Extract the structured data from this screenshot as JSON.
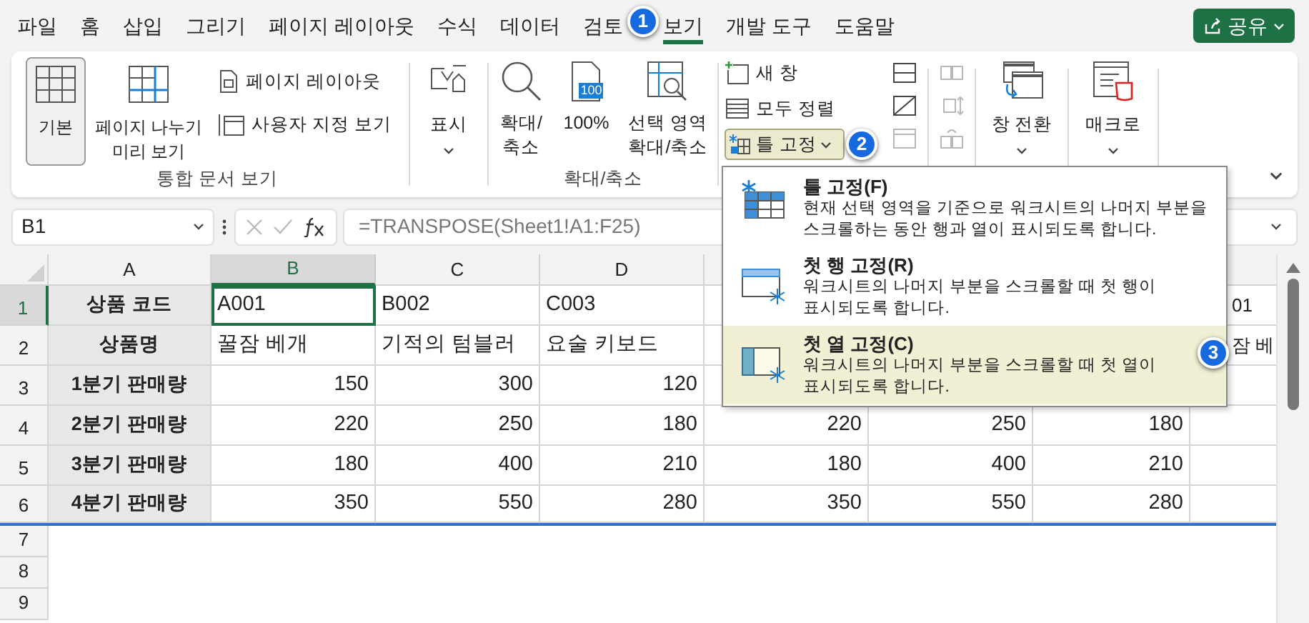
{
  "menu_tabs": [
    {
      "label": "파일",
      "selected": false
    },
    {
      "label": "홈",
      "selected": false
    },
    {
      "label": "삽입",
      "selected": false
    },
    {
      "label": "그리기",
      "selected": false
    },
    {
      "label": "페이지 레이아웃",
      "selected": false
    },
    {
      "label": "수식",
      "selected": false
    },
    {
      "label": "데이터",
      "selected": false
    },
    {
      "label": "검토",
      "selected": false
    },
    {
      "label": "보기",
      "selected": true
    },
    {
      "label": "개발 도구",
      "selected": false
    },
    {
      "label": "도움말",
      "selected": false
    }
  ],
  "share_button": {
    "label": "공유"
  },
  "ribbon": {
    "workbook_views": {
      "label": "통합 문서 보기",
      "large_buttons": [
        {
          "label": "기본",
          "selected": true
        },
        {
          "label": "페이지 나누기\n미리 보기",
          "selected": false
        }
      ],
      "small_buttons": [
        "페이지 레이아웃",
        "사용자 지정 보기"
      ]
    },
    "show": {
      "label": "표시"
    },
    "zoom": {
      "label": "확대/축소",
      "buttons": [
        "확대/\n축소",
        "100%",
        "선택 영역\n확대/축소"
      ],
      "icon_text": "100"
    },
    "window": {
      "small_buttons": [
        "새 창",
        "모두 정렬"
      ],
      "freeze_button": {
        "label": "틀 고정",
        "pressed": true
      },
      "icon_buttons": [
        {
          "disabled": false
        },
        {
          "disabled": false
        },
        {
          "disabled": true
        },
        {
          "disabled": true
        },
        {
          "disabled": true
        },
        {
          "disabled": true
        }
      ],
      "switch_windows": {
        "label": "창 전환"
      }
    },
    "macros": {
      "label": "매크로"
    }
  },
  "formula_bar": {
    "name_box": "B1",
    "formula": "=TRANSPOSE(Sheet1!A1:F25)"
  },
  "sheet": {
    "columns": [
      {
        "label": "A",
        "selected": false
      },
      {
        "label": "B",
        "selected": true
      },
      {
        "label": "C",
        "selected": false
      },
      {
        "label": "D",
        "selected": false
      }
    ],
    "rows": [
      {
        "header": "1",
        "selected": true,
        "kind": "text",
        "cells": [
          {
            "text": "상품 코드",
            "selected": false
          },
          {
            "text": "A001",
            "selected": true
          },
          {
            "text": "B002",
            "selected": false
          },
          {
            "text": "C003",
            "selected": false
          },
          null,
          null,
          null,
          {
            "text": "01",
            "selected": false
          }
        ]
      },
      {
        "header": "2",
        "selected": false,
        "kind": "text",
        "cells": [
          {
            "text": "상품명",
            "selected": false
          },
          {
            "text": "꿀잠 베개",
            "selected": false
          },
          {
            "text": "기적의 텀블러",
            "selected": false
          },
          {
            "text": "요술 키보드",
            "selected": false
          },
          null,
          null,
          null,
          {
            "text": "잠 베",
            "selected": false
          }
        ]
      },
      {
        "header": "3",
        "selected": false,
        "kind": "number",
        "cells": [
          {
            "text": "1분기 판매량",
            "selected": false
          },
          {
            "text": "150",
            "selected": false
          },
          {
            "text": "300",
            "selected": false
          },
          {
            "text": "120",
            "selected": false
          },
          null,
          null,
          null,
          null
        ]
      },
      {
        "header": "4",
        "selected": false,
        "kind": "number",
        "cells": [
          {
            "text": "2분기 판매량",
            "selected": false
          },
          {
            "text": "220",
            "selected": false
          },
          {
            "text": "250",
            "selected": false
          },
          {
            "text": "180",
            "selected": false
          },
          {
            "text": "220",
            "selected": false
          },
          {
            "text": "250",
            "selected": false
          },
          {
            "text": "180",
            "selected": false
          },
          null
        ]
      },
      {
        "header": "5",
        "selected": false,
        "kind": "number",
        "cells": [
          {
            "text": "3분기 판매량",
            "selected": false
          },
          {
            "text": "180",
            "selected": false
          },
          {
            "text": "400",
            "selected": false
          },
          {
            "text": "210",
            "selected": false
          },
          {
            "text": "180",
            "selected": false
          },
          {
            "text": "400",
            "selected": false
          },
          {
            "text": "210",
            "selected": false
          },
          null
        ]
      },
      {
        "header": "6",
        "selected": false,
        "kind": "number",
        "cells": [
          {
            "text": "4분기 판매량",
            "selected": false
          },
          {
            "text": "350",
            "selected": false
          },
          {
            "text": "550",
            "selected": false
          },
          {
            "text": "280",
            "selected": false
          },
          {
            "text": "350",
            "selected": false
          },
          {
            "text": "550",
            "selected": false
          },
          {
            "text": "280",
            "selected": false
          },
          null
        ]
      },
      {
        "header": "7",
        "selected": false,
        "kind": "empty",
        "cells": []
      },
      {
        "header": "8",
        "selected": false,
        "kind": "empty",
        "cells": []
      },
      {
        "header": "9",
        "selected": false,
        "kind": "empty",
        "cells": []
      }
    ]
  },
  "freeze_menu": {
    "items": [
      {
        "title": "틀 고정(F)",
        "description": "현재 선택 영역을 기준으로 워크시트의 나머지 부분을\n스크롤하는 동안 행과 열이 표시되도록 합니다.",
        "selected": false
      },
      {
        "title": "첫 행 고정(R)",
        "description": "워크시트의 나머지 부분을 스크롤할 때 첫 행이\n표시되도록 합니다.",
        "selected": false
      },
      {
        "title": "첫 열 고정(C)",
        "description": "워크시트의 나머지 부분을 스크롤할 때 첫 열이\n표시되도록 합니다.",
        "selected": true
      }
    ]
  },
  "callouts": [
    {
      "label": "1"
    },
    {
      "label": "2"
    },
    {
      "label": "3"
    }
  ]
}
